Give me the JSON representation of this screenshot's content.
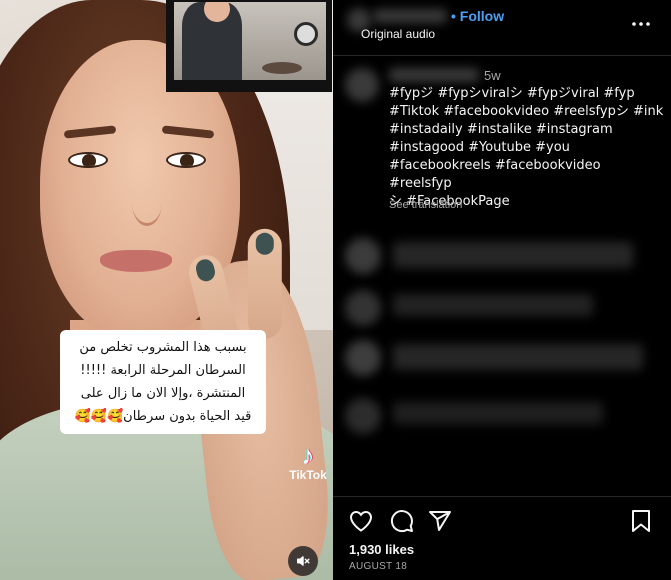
{
  "post": {
    "username": "",
    "follow_label": "Follow",
    "audio_label": "Original audio",
    "comment_time": "5w",
    "hashtag_lines": [
      "#fypジ #fypシviralシ #fypジviral #fyp",
      "#Tiktok #facebookvideo #reelsfypシ #ink",
      "#instadaily #instalike #instagram",
      "#instagood #Youtube #you",
      "#facebookreels #facebookvideo #reelsfyp",
      "シ #FacebookPage"
    ],
    "see_translation": "See translation",
    "likes": "1,930 likes",
    "date": "AUGUST 18"
  },
  "video": {
    "caption_lines": [
      "بسبب هذا المشروب تخلص من",
      "السرطان المرحلة الرابعة !!!!!",
      "المنتشرة ،وإلا الان ما زال على",
      "قيد الحياة بدون سرطان🥰🥰🥰"
    ],
    "watermark": "TikTok"
  },
  "icons": {
    "more": "more-options-icon",
    "like": "heart-icon",
    "comment": "comment-icon",
    "share": "share-icon",
    "save": "bookmark-icon",
    "mute": "muted-speaker-icon"
  },
  "colors": {
    "background": "#000000",
    "follow": "#4aa0f5",
    "muted_text": "#a8a8a8"
  }
}
